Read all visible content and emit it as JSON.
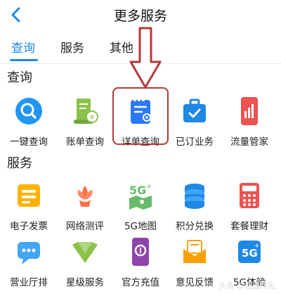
{
  "header": {
    "title": "更多服务",
    "back_icon": "chevron-left-icon"
  },
  "tabs": [
    {
      "label": "查询",
      "active": true
    },
    {
      "label": "服务",
      "active": false
    },
    {
      "label": "其他",
      "active": false
    }
  ],
  "sections": {
    "query": {
      "title": "查询",
      "items": [
        {
          "label": "一键查询",
          "icon": "search-icon",
          "color": "#2196f3"
        },
        {
          "label": "账单查询",
          "icon": "bill-scroll-icon",
          "color": "#8bc34a"
        },
        {
          "label": "详单查询",
          "icon": "detail-list-icon",
          "color": "#2979ff"
        },
        {
          "label": "已订业务",
          "icon": "briefcase-check-icon",
          "color": "#1e88e5"
        },
        {
          "label": "流量管家",
          "icon": "data-phone-icon",
          "color": "#ef5350"
        }
      ]
    },
    "service": {
      "title": "服务",
      "items": [
        {
          "label": "电子发票",
          "icon": "invoice-icon",
          "color": "#ffb300"
        },
        {
          "label": "网络测评",
          "icon": "flower-icon",
          "color": "#ff7043"
        },
        {
          "label": "5G地图",
          "icon": "5g-map-icon",
          "color": "#66bb6a"
        },
        {
          "label": "积分兑换",
          "icon": "coins-stack-icon",
          "color": "#1e88e5"
        },
        {
          "label": "套餐理财",
          "icon": "calculator-icon",
          "color": "#ef5350"
        },
        {
          "label": "营业厅排",
          "icon": "chat-bubble-icon",
          "color": "#42a5f5"
        },
        {
          "label": "星级服务",
          "icon": "star-chevron-icon",
          "color": "#8bc34a"
        },
        {
          "label": "官方充值",
          "icon": "phone-recharge-icon",
          "color": "#8e44ad"
        },
        {
          "label": "意见反馈",
          "icon": "mail-feedback-icon",
          "color": "#ffa000"
        },
        {
          "label": "5G体验",
          "icon": "5g-experience-icon",
          "color": "#1e88e5"
        }
      ]
    }
  },
  "annotation": {
    "highlight_color": "#b23a3a",
    "arrow_icon": "down-arrow-icon"
  },
  "watermark": "头条 @遥遥领先"
}
